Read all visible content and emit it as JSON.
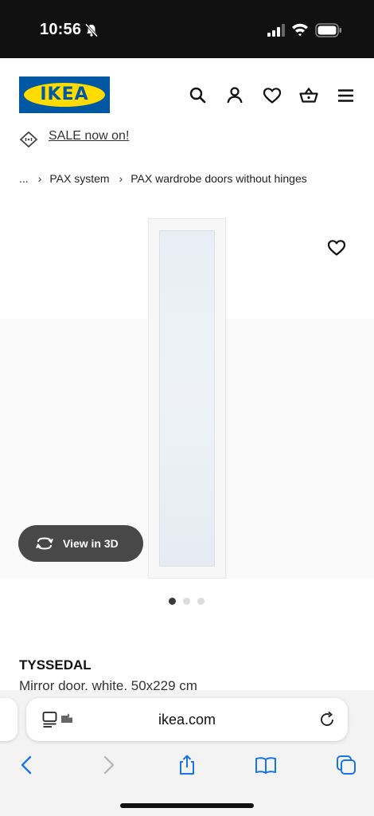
{
  "status": {
    "time": "10:56"
  },
  "header": {
    "logo_text": "IKEA",
    "brand_colors": {
      "blue": "#0058a3",
      "yellow": "#ffdb00"
    },
    "icons": [
      "search-icon",
      "account-icon",
      "heart-icon",
      "basket-icon",
      "menu-icon"
    ]
  },
  "sale": {
    "label": "SALE now on!"
  },
  "breadcrumb": {
    "ellipsis": "...",
    "items": [
      "PAX system",
      "PAX wardrobe doors without hinges"
    ]
  },
  "product": {
    "view3d_label": "View in 3D",
    "name": "TYSSEDAL",
    "description": "Mirror door, white, 50x229 cm",
    "image_count": 3,
    "active_image": 1
  },
  "browser": {
    "url": "ikea.com"
  }
}
